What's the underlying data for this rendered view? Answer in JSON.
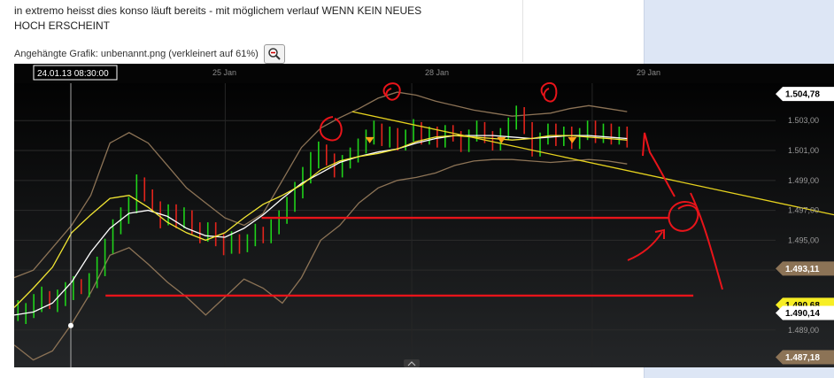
{
  "post": {
    "text_line1": "in extremo heisst dies konso läuft bereits - mit möglichem verlauf WENN KEIN NEUES",
    "text_line2": "HOCH ERSCHEINT",
    "attachment_label": "Angehängte Grafik: unbenannt.png (verkleinert auf 61%)"
  },
  "icons": {
    "zoom": "magnifier-minus-icon",
    "scroll": "chevron-up-icon"
  },
  "colors": {
    "background": "#0b0b0b",
    "band": "#8c7356",
    "ma_fast": "#f2e633",
    "ma_slow": "#ffffff",
    "bull": "#1fd21a",
    "bear": "#e3241c",
    "annotation": "#e8141a",
    "trendline": "#e6d21e",
    "marker": "#ffa218"
  },
  "chart_data": {
    "type": "line",
    "time_labels": [
      "25 Jan",
      "28 Jan",
      "29 Jan"
    ],
    "cursor_label": "24.01.13 08:30:00",
    "y_ticks": [
      "1.503,00",
      "1.501,00",
      "1.499,00",
      "1.497,00",
      "1.495,00",
      "1.493,00",
      "1.489,00"
    ],
    "ylim": [
      1.4865,
      1.5055
    ],
    "price_tags": [
      {
        "label": "1.504,78",
        "value": 1.50478,
        "style": "white"
      },
      {
        "label": "1.493,11",
        "value": 1.49311,
        "style": "tan"
      },
      {
        "label": "1.490,68",
        "value": 1.49068,
        "style": "yellow"
      },
      {
        "label": "1.490,14",
        "value": 1.49014,
        "style": "white"
      },
      {
        "label": "1.487,18",
        "value": 1.48718,
        "style": "tan"
      }
    ],
    "upper_band": [
      1.4925,
      1.493,
      1.4945,
      1.496,
      1.498,
      1.5015,
      1.5022,
      1.5015,
      1.5,
      1.4985,
      1.4975,
      1.4965,
      1.496,
      1.4968,
      1.499,
      1.5012,
      1.5025,
      1.5032,
      1.5038,
      1.5045,
      1.5049,
      1.5047,
      1.5043,
      1.504,
      1.5037,
      1.5035,
      1.5033,
      1.5034,
      1.5035,
      1.5038,
      1.504,
      1.5038,
      1.5036
    ],
    "lower_band": [
      1.488,
      1.487,
      1.4876,
      1.4894,
      1.4915,
      1.494,
      1.4945,
      1.4934,
      1.4922,
      1.4912,
      1.49,
      1.4912,
      1.4924,
      1.4918,
      1.4908,
      1.4925,
      1.495,
      1.496,
      1.4975,
      1.4985,
      1.499,
      1.4992,
      1.4995,
      1.5,
      1.5003,
      1.5004,
      1.5004,
      1.5003,
      1.5002,
      1.5003,
      1.5004,
      1.5003,
      1.5001
    ],
    "ma_fast": [
      1.4905,
      1.4918,
      1.4932,
      1.4955,
      1.4967,
      1.4978,
      1.498,
      1.4972,
      1.4962,
      1.4955,
      1.495,
      1.4955,
      1.4965,
      1.4974,
      1.498,
      1.4987,
      1.4997,
      1.5003,
      1.5006,
      1.5008,
      1.5011,
      1.5016,
      1.5019,
      1.502,
      1.5019,
      1.5018,
      1.5017,
      1.5018,
      1.502,
      1.502,
      1.5019,
      1.5018,
      1.5017
    ],
    "ma_slow": [
      1.49,
      1.4902,
      1.4908,
      1.4922,
      1.4942,
      1.4958,
      1.4968,
      1.497,
      1.4966,
      1.4958,
      1.4953,
      1.4952,
      1.4958,
      1.4967,
      1.4978,
      1.4988,
      1.4995,
      1.5002,
      1.5006,
      1.5009,
      1.5011,
      1.5015,
      1.5018,
      1.502,
      1.502,
      1.502,
      1.5019,
      1.5018,
      1.5019,
      1.502,
      1.502,
      1.5019,
      1.5018
    ],
    "candles": [
      [
        1.49,
        1.4906
      ],
      [
        1.4898,
        1.4904
      ],
      [
        1.4902,
        1.491
      ],
      [
        1.4906,
        1.4915
      ],
      [
        1.4912,
        1.4908
      ],
      [
        1.4906,
        1.4913
      ],
      [
        1.491,
        1.4918
      ],
      [
        1.4914,
        1.4922
      ],
      [
        1.492,
        1.4918
      ],
      [
        1.4916,
        1.4924
      ],
      [
        1.4922,
        1.4935
      ],
      [
        1.493,
        1.4947
      ],
      [
        1.4945,
        1.496
      ],
      [
        1.4958,
        1.4968
      ],
      [
        1.4965,
        1.4975
      ],
      [
        1.4972,
        1.499
      ],
      [
        1.4988,
        1.498
      ],
      [
        1.498,
        1.4973
      ],
      [
        1.4972,
        1.4962
      ],
      [
        1.4964,
        1.497
      ],
      [
        1.497,
        1.4962
      ],
      [
        1.4962,
        1.4968
      ],
      [
        1.4966,
        1.4958
      ],
      [
        1.4958,
        1.4952
      ],
      [
        1.4953,
        1.4958
      ],
      [
        1.4958,
        1.495
      ],
      [
        1.495,
        1.4944
      ],
      [
        1.4945,
        1.4952
      ],
      [
        1.495,
        1.4945
      ],
      [
        1.4946,
        1.495
      ],
      [
        1.495,
        1.4957
      ],
      [
        1.4955,
        1.4952
      ],
      [
        1.4952,
        1.496
      ],
      [
        1.4958,
        1.4966
      ],
      [
        1.4965,
        1.4975
      ],
      [
        1.4973,
        1.4985
      ],
      [
        1.4982,
        1.4995
      ],
      [
        1.4992,
        1.5005
      ],
      [
        1.5002,
        1.5012
      ],
      [
        1.501,
        1.5004
      ],
      [
        1.5004,
        1.4996
      ],
      [
        1.4996,
        1.5003
      ],
      [
        1.5002,
        1.5008
      ],
      [
        1.5006,
        1.5014
      ],
      [
        1.5012,
        1.502
      ],
      [
        1.5018,
        1.5026
      ],
      [
        1.5024,
        1.5017
      ],
      [
        1.5016,
        1.5022
      ],
      [
        1.5021,
        1.5014
      ],
      [
        1.5014,
        1.502
      ],
      [
        1.502,
        1.5027
      ],
      [
        1.5025,
        1.5018
      ],
      [
        1.5018,
        1.5022
      ],
      [
        1.5022,
        1.5016
      ],
      [
        1.5016,
        1.5023
      ],
      [
        1.5023,
        1.502
      ],
      [
        1.5019,
        1.5013
      ],
      [
        1.5013,
        1.502
      ],
      [
        1.502,
        1.5026
      ],
      [
        1.5025,
        1.5019
      ],
      [
        1.5019,
        1.5014
      ],
      [
        1.5014,
        1.5021
      ],
      [
        1.5021,
        1.5028
      ],
      [
        1.5028,
        1.5036
      ],
      [
        1.5035,
        1.5025
      ],
      [
        1.5025,
        1.501
      ],
      [
        1.501,
        1.5018
      ],
      [
        1.5018,
        1.5024
      ],
      [
        1.5024,
        1.5017
      ],
      [
        1.5017,
        1.5022
      ],
      [
        1.5022,
        1.5015
      ],
      [
        1.5015,
        1.5021
      ],
      [
        1.5021,
        1.5026
      ],
      [
        1.5026,
        1.5019
      ],
      [
        1.5019,
        1.5024
      ],
      [
        1.5024,
        1.5018
      ],
      [
        1.5018,
        1.5022
      ],
      [
        1.5022,
        1.5016
      ]
    ],
    "trendline": {
      "from": [
        0.444,
        1.5036
      ],
      "to": [
        1.0,
        1.4967
      ]
    },
    "support_levels": [
      {
        "value": 1.4965,
        "from": 0.325,
        "to": 0.86
      },
      {
        "value": 1.4913,
        "from": 0.12,
        "to": 0.892
      }
    ],
    "markers": [
      0.467,
      0.64,
      0.733
    ],
    "grid": true,
    "legend": "none"
  }
}
